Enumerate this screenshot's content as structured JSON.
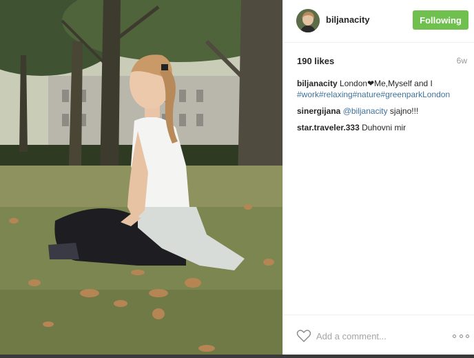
{
  "post": {
    "username": "biljanacity",
    "follow_label": "Following",
    "likes": "190 likes",
    "age": "6w"
  },
  "comments": [
    {
      "user": "biljanacity",
      "text_before": " London",
      "text_after": "Me,Myself and I",
      "hashtags": "#work#relaxing#nature#greenparkLondon"
    },
    {
      "user": "sinergijana",
      "mention": "@biljanacity",
      "text": " sjajno!!!"
    },
    {
      "user": "star.traveler.333",
      "text": " Duhovni mir"
    }
  ],
  "footer": {
    "comment_placeholder": "Add a comment..."
  },
  "colors": {
    "follow_button": "#70c050",
    "link": "#3f729b"
  },
  "icons": {
    "like": "heart-outline-icon",
    "more": "more-options-icon"
  }
}
